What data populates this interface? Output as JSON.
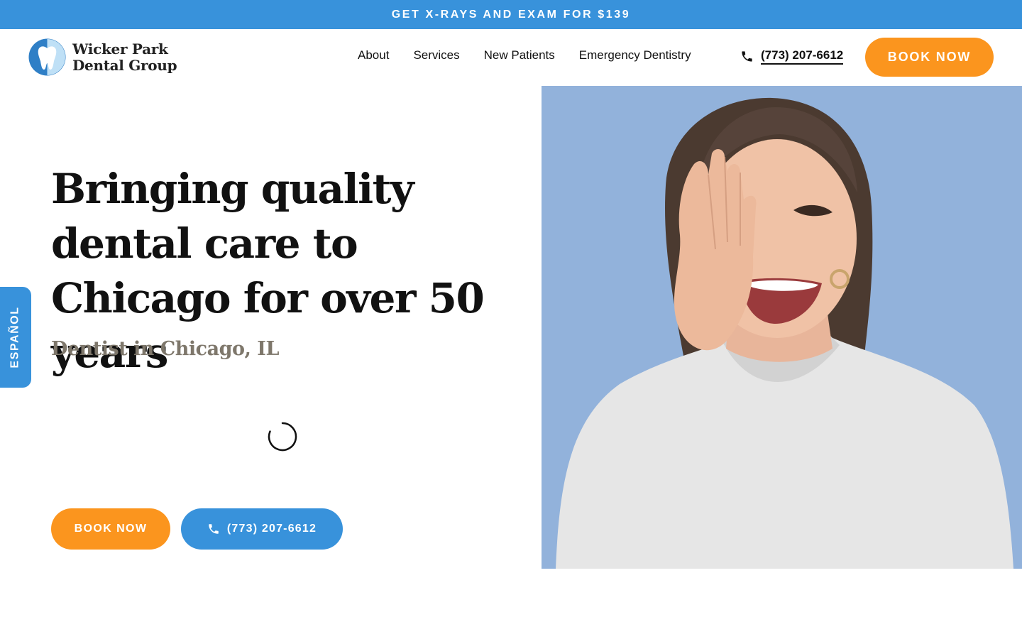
{
  "promo": {
    "text": "GET X-RAYS AND EXAM FOR $139"
  },
  "logo": {
    "line1": "Wicker Park",
    "line2": "Dental Group",
    "icon": "tooth-icon"
  },
  "nav": {
    "items": [
      {
        "label": "About"
      },
      {
        "label": "Services"
      },
      {
        "label": "New Patients"
      },
      {
        "label": "Emergency Dentistry"
      }
    ]
  },
  "header": {
    "phone": "(773) 207-6612",
    "phone_icon": "phone-icon",
    "book_label": "BOOK NOW"
  },
  "hero": {
    "title": "Bringing quality dental care to Chicago for over 50 years",
    "subtitle": "Dentist in Chicago, IL",
    "book_label": "BOOK NOW",
    "phone_label": "(773) 207-6612",
    "image_icon": "smiling-woman-photo"
  },
  "language_tab": {
    "label": "ESPAÑOL"
  },
  "colors": {
    "brand_blue": "#3892db",
    "accent_orange": "#fb951e",
    "photo_bg": "#92b2db",
    "subtitle_gray": "#7e776b"
  }
}
